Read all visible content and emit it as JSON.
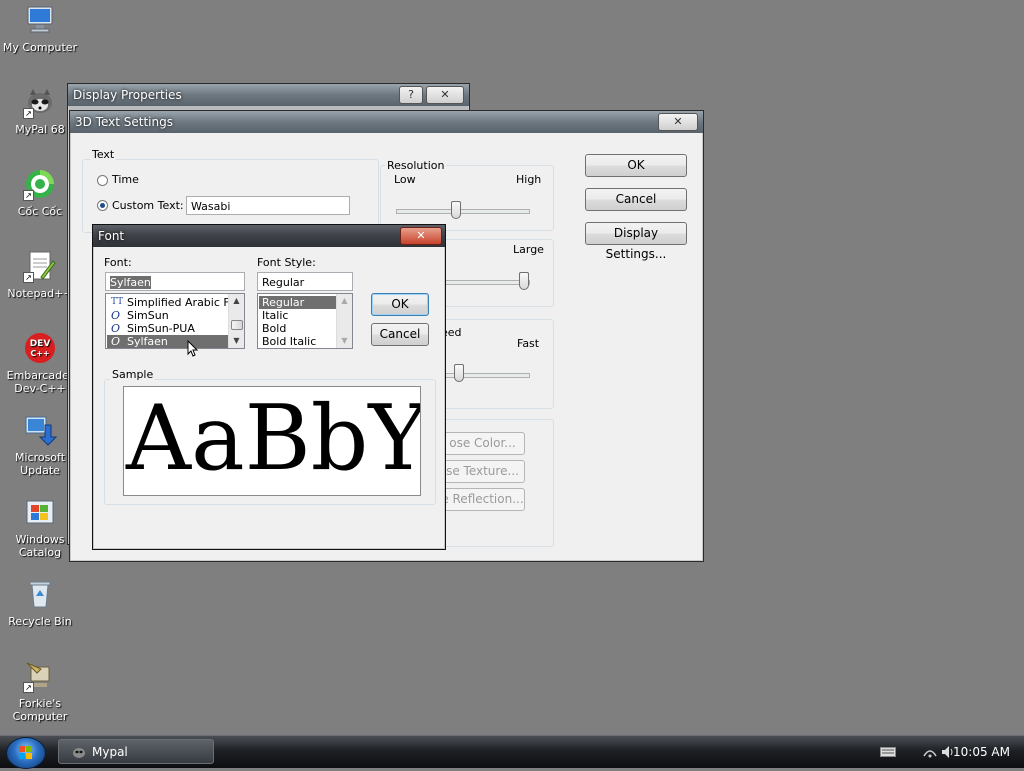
{
  "desktop": {
    "icons": [
      {
        "label": "My Computer"
      },
      {
        "label": "MyPal 68"
      },
      {
        "label": "Cốc Cốc"
      },
      {
        "label": "Notepad++"
      },
      {
        "label": "Embarcadero Dev-C++",
        "line1": "Embarcader",
        "line2": "Dev-C++"
      },
      {
        "label": "Microsoft Update",
        "line1": "Microsoft",
        "line2": "Update"
      },
      {
        "label": "Windows Catalog",
        "line1": "Windows",
        "line2": "Catalog"
      },
      {
        "label": "Recycle Bin"
      },
      {
        "label": "Forkie's Computer",
        "line1": "Forkie's",
        "line2": "Computer"
      }
    ]
  },
  "display_properties": {
    "title": "Display Properties",
    "help_btn": "?",
    "close_btn": "✕"
  },
  "text_settings": {
    "title": "3D Text Settings",
    "close_btn": "✕",
    "text_group": "Text",
    "time_label": "Time",
    "custom_label": "Custom Text:",
    "custom_value": "Wasabi",
    "resolution_group": "Resolution",
    "res_low": "Low",
    "res_high": "High",
    "size_large": "Large",
    "speed_partial": "eed",
    "speed_fast": "Fast",
    "color_btn": "ose Color...",
    "texture_btn": "se Texture...",
    "reflection_btn": "e Reflection...",
    "ok": "OK",
    "cancel": "Cancel",
    "display_settings": "Display Settings..."
  },
  "font_dialog": {
    "title": "Font",
    "close_btn": "✕",
    "font_label": "Font:",
    "font_value": "Sylfaen",
    "font_items": [
      {
        "name": "Simplified Arabic Fixed",
        "icon": "TT"
      },
      {
        "name": "SimSun",
        "icon": "O"
      },
      {
        "name": "SimSun-PUA",
        "icon": "O"
      },
      {
        "name": "Sylfaen",
        "icon": "O"
      }
    ],
    "style_label": "Font Style:",
    "style_value": "Regular",
    "style_items": [
      "Regular",
      "Italic",
      "Bold",
      "Bold Italic"
    ],
    "ok": "OK",
    "cancel": "Cancel",
    "sample_label": "Sample",
    "sample_text": "AaBbYy"
  },
  "taskbar": {
    "task_label": "Mypal",
    "clock": "10:05 AM"
  }
}
